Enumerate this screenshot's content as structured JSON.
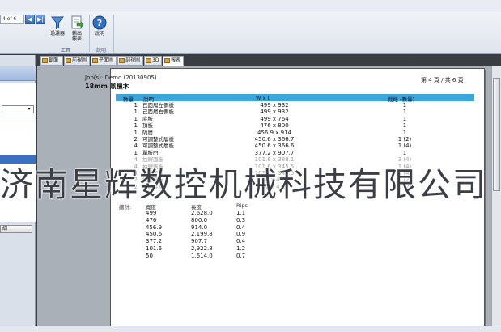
{
  "ribbon": {
    "page_indicator": "4 of 6",
    "buttons": [
      {
        "label": "過濾器",
        "icon": "filter-icon"
      },
      {
        "label": "輸出\n報表",
        "icon": "export-report-icon"
      },
      {
        "label": "說明",
        "icon": "help-icon"
      }
    ],
    "groups": [
      "工具",
      "說明"
    ]
  },
  "left_panel": {
    "button_label": "細"
  },
  "tabs": [
    {
      "label": "斷面",
      "active": false
    },
    {
      "label": "前視圖",
      "active": false
    },
    {
      "label": "平面圖",
      "active": false
    },
    {
      "label": "剖視圖",
      "active": false
    },
    {
      "label": "3D",
      "active": false
    },
    {
      "label": "報表",
      "active": true
    }
  ],
  "report": {
    "job": "Job(s): Demo (20130905)",
    "board": "18mm 黑檀木",
    "page": "第 4 頁 / 共 6 頁",
    "headers": {
      "qty": "數量",
      "desc": "說明",
      "size": "W x L",
      "bars": "裁條 (數量)"
    },
    "rows": [
      {
        "qty": "1",
        "desc": "己面層左側板",
        "size": "499 x 932",
        "bars": "1"
      },
      {
        "qty": "1",
        "desc": "己面層右側板",
        "size": "499 x 932",
        "bars": "1"
      },
      {
        "qty": "1",
        "desc": "底板",
        "size": "499 x 764",
        "bars": "1"
      },
      {
        "qty": "1",
        "desc": "頂板",
        "size": "476 x 800",
        "bars": "1"
      },
      {
        "qty": "1",
        "desc": "隔層",
        "size": "456.9 x 914",
        "bars": "1"
      },
      {
        "qty": "2",
        "desc": "可調整式層板",
        "size": "450.6 x 366.7",
        "bars": "1 (2)"
      },
      {
        "qty": "4",
        "desc": "可調整式層板",
        "size": "450.6 x 366.6",
        "bars": "1 (4)"
      },
      {
        "qty": "1",
        "desc": "單板門",
        "size": "377.2 x 907.7",
        "bars": "1"
      },
      {
        "qty": "4",
        "desc": "抽屜面板",
        "size": "101.6 x 388.1",
        "bars": "3 (4)"
      },
      {
        "qty": "4",
        "desc": "抽屜側板",
        "size": "101.6 x 345.5",
        "bars": "1 (4)"
      },
      {
        "qty": "4",
        "desc": "抽屜背板",
        "size": "101.6 x 345.5",
        "bars": "1 (4)"
      },
      {
        "qty": "2",
        "desc": "抽屜底板",
        "size": "50 x 432",
        "bars": "1 (2)"
      },
      {
        "qty": "2",
        "desc": "抽屜底板",
        "size": "50 x 432",
        "bars": "1 (2)"
      }
    ],
    "summary": {
      "headers": {
        "label": "總計:",
        "width": "寬度",
        "length": "長度",
        "rips": "Rips"
      },
      "rows": [
        {
          "w": "499",
          "l": "2,628.0",
          "r": "1.1"
        },
        {
          "w": "476",
          "l": "800.0",
          "r": "0.3"
        },
        {
          "w": "456.9",
          "l": "914.0",
          "r": "0.4"
        },
        {
          "w": "450.6",
          "l": "2,199.8",
          "r": "0.9"
        },
        {
          "w": "377.2",
          "l": "907.7",
          "r": "0.4"
        },
        {
          "w": "101.6",
          "l": "2,922.8",
          "r": "1.2"
        },
        {
          "w": "50",
          "l": "1,614.0",
          "r": "0.7"
        }
      ]
    }
  },
  "watermark": "济南星辉数控机械科技有限公司",
  "colors": {
    "table_header": "#39a7dd",
    "selection": "#3a6fc4"
  }
}
